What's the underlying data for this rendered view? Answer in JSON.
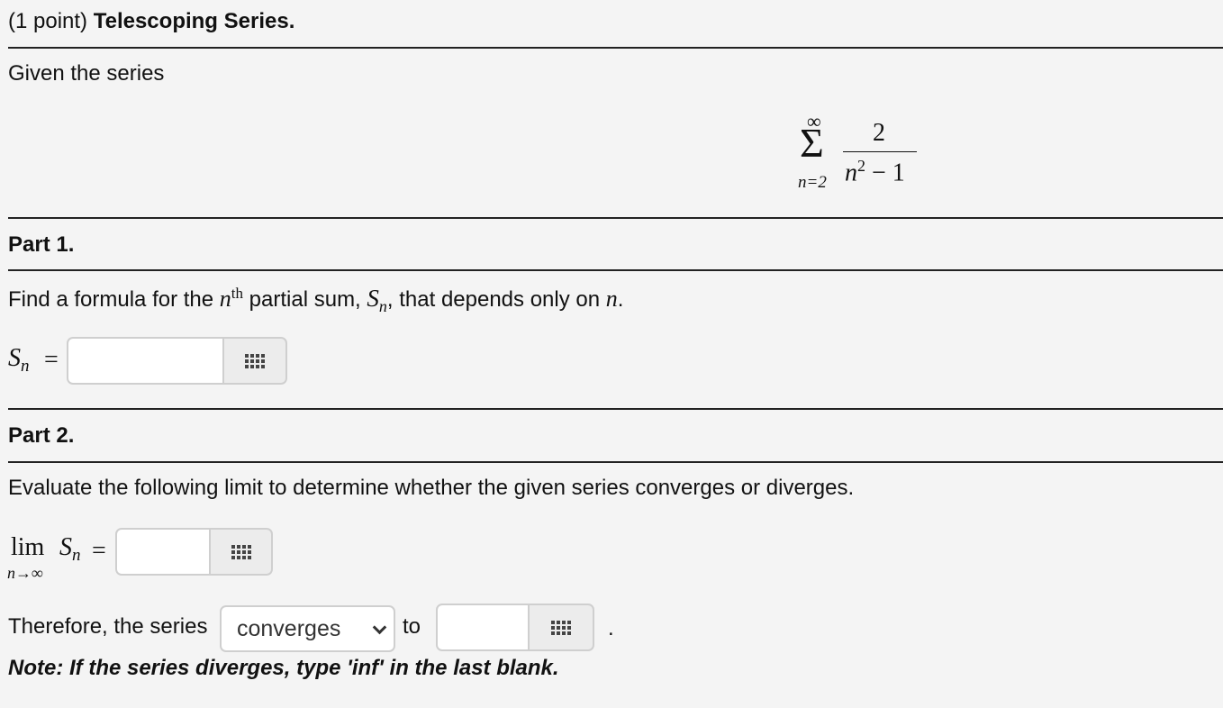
{
  "header": {
    "points": "(1 point)",
    "title": "Telescoping Series."
  },
  "intro": {
    "text": "Given the series"
  },
  "series_formula": {
    "sum_upper": "∞",
    "sum_symbol": "Σ",
    "sum_lower": "n=2",
    "numerator": "2",
    "denominator_base": "n",
    "denominator_exp": "2",
    "denominator_rest": " − 1"
  },
  "part1": {
    "heading": "Part 1.",
    "prompt_a": "Find a formula for the ",
    "prompt_n": "n",
    "prompt_th": "th",
    "prompt_b": " partial sum, ",
    "prompt_S": "S",
    "prompt_Ssub": "n",
    "prompt_c": ", that depends only on ",
    "prompt_var": "n",
    "prompt_end": ".",
    "label_S": "S",
    "label_sub": "n",
    "equals": "=",
    "answer_value": ""
  },
  "part2": {
    "heading": "Part 2.",
    "prompt": "Evaluate the following limit to determine whether the given series converges or diverges.",
    "lim_word": "lim",
    "lim_sub": "n→∞",
    "lim_S": "S",
    "lim_Ssub": "n",
    "equals": "=",
    "limit_value": "",
    "therefore_text": "Therefore, the series",
    "select_value": "converges",
    "to_text": "to",
    "final_value": "",
    "period": ".",
    "note": "Note: If the series diverges, type 'inf' in the last blank."
  },
  "icons": {
    "palette": "equation-palette-icon",
    "dropdown": "chevron-down-icon"
  }
}
